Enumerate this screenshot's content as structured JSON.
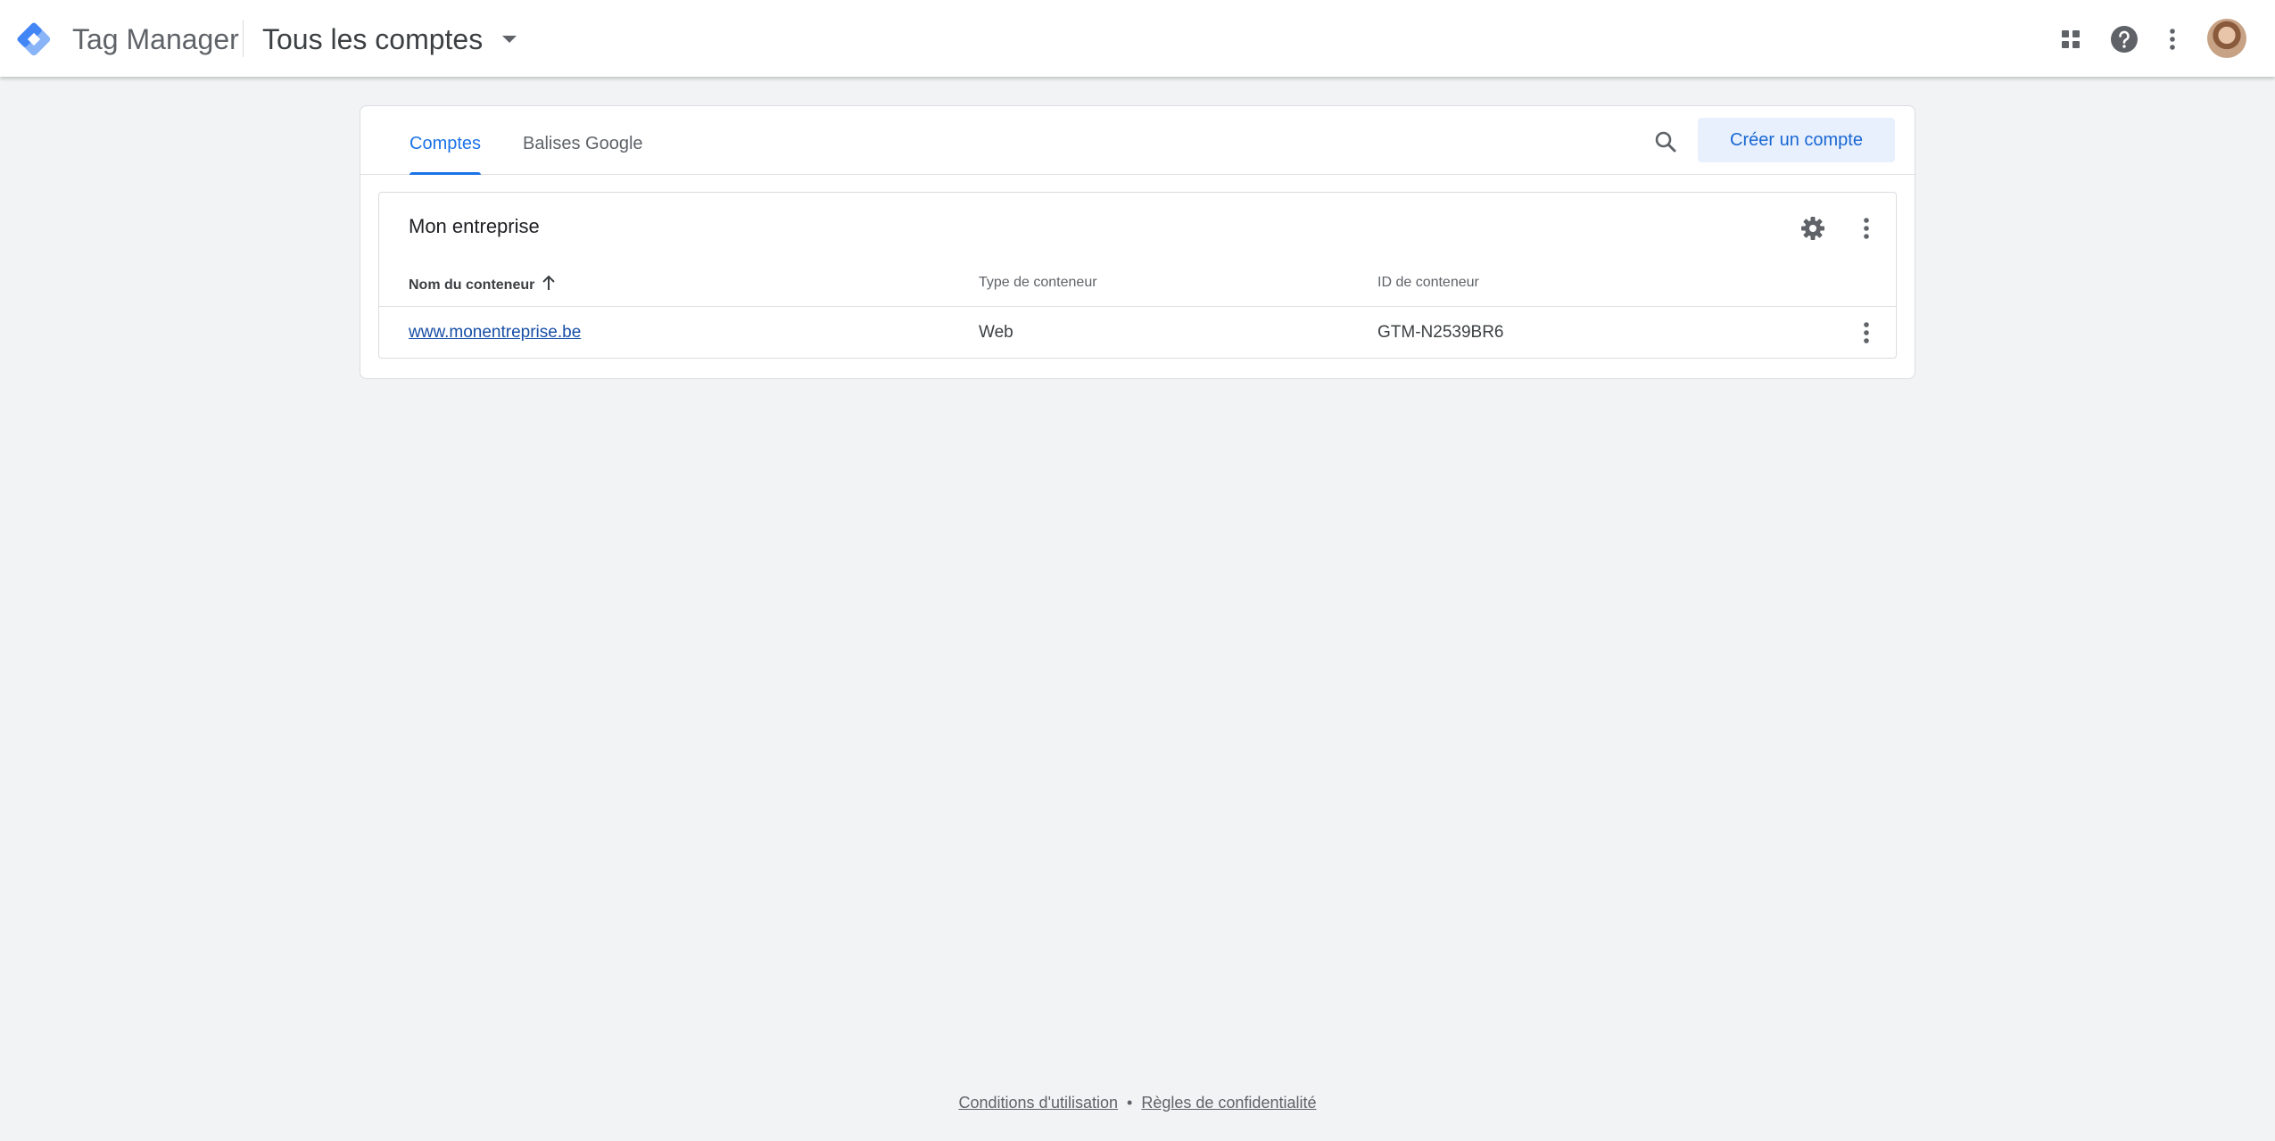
{
  "appbar": {
    "product_name": "Tag Manager",
    "account_switcher_label": "Tous les comptes",
    "icons": [
      "apps-grid-icon",
      "help-icon",
      "more-vert-icon",
      "avatar"
    ]
  },
  "tabs": [
    {
      "label": "Comptes",
      "active": true
    },
    {
      "label": "Balises Google",
      "active": false
    }
  ],
  "toolbar": {
    "create_label": "Créer un compte"
  },
  "account": {
    "name": "Mon entreprise",
    "columns": [
      "Nom du conteneur",
      "Type de conteneur",
      "ID de conteneur"
    ],
    "rows": [
      {
        "name": "www.monentreprise.be",
        "type": "Web",
        "id": "GTM-N2539BR6"
      }
    ]
  },
  "footer": {
    "terms": "Conditions d'utilisation",
    "separator": "•",
    "privacy": "Règles de confidentialité"
  },
  "colors": {
    "accent": "#1a73e8",
    "background": "#f1f3f4",
    "button_bg": "#e8f0fe"
  }
}
